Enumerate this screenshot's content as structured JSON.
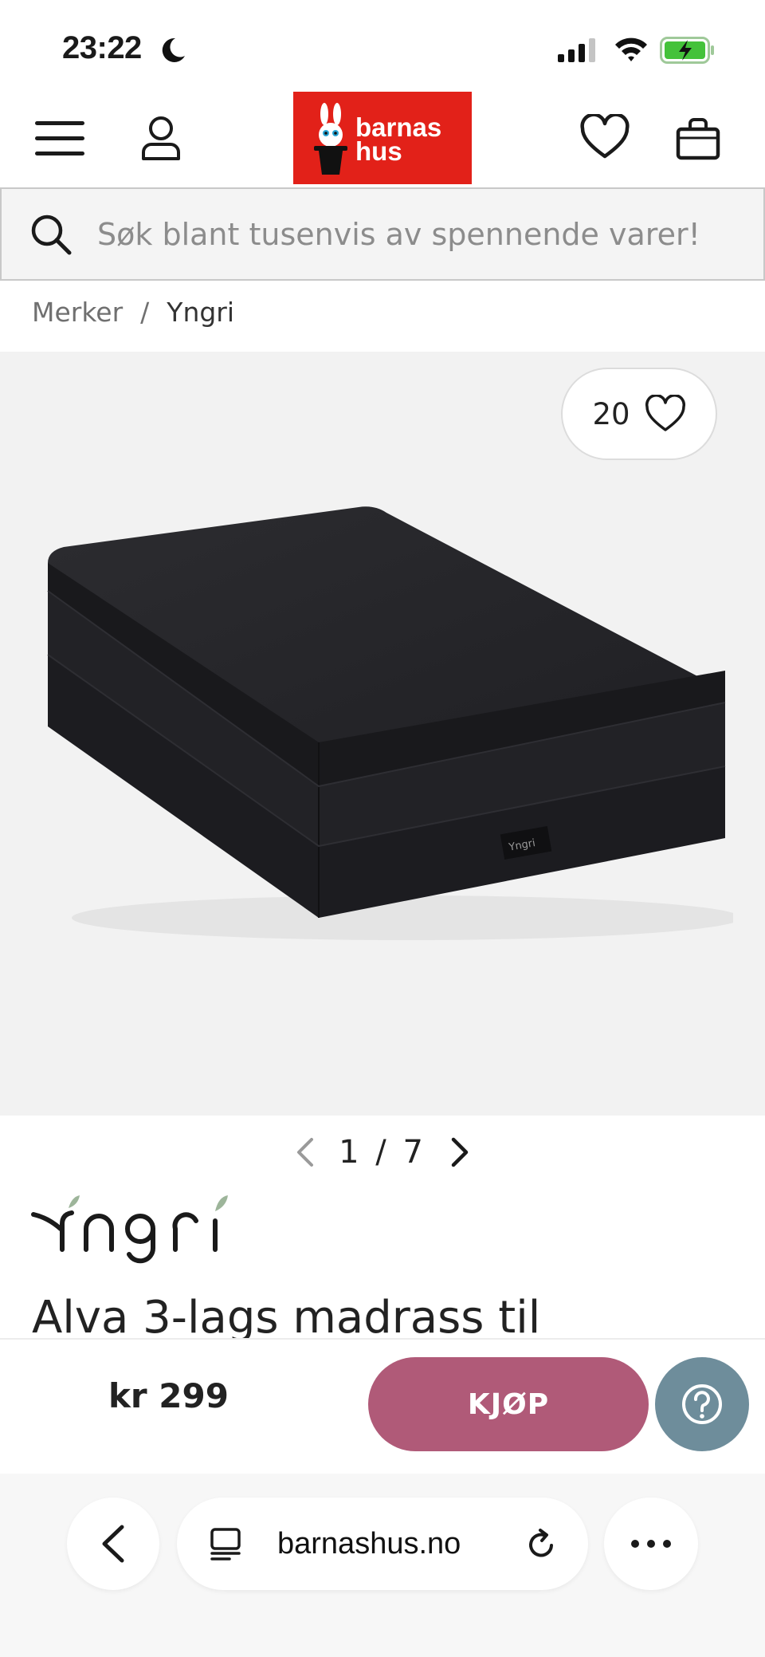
{
  "status_bar": {
    "time": "23:22",
    "icons": [
      "moon-icon",
      "signal-icon",
      "wifi-icon",
      "battery-charging-icon"
    ]
  },
  "header": {
    "logo_line1": "barnas",
    "logo_line2": "hus",
    "icons": [
      "menu-icon",
      "account-icon",
      "heart-icon",
      "bag-icon"
    ],
    "logo_color": "#e22119"
  },
  "search": {
    "placeholder": "Søk blant tusenvis av spennende varer!"
  },
  "breadcrumb": {
    "items": [
      "Merker",
      "Yngri"
    ],
    "separator": "/"
  },
  "product": {
    "favorite_count": "20",
    "image_pager": "1 / 7",
    "brand": "Yngri",
    "mattress_label": "Yngri",
    "title": "Alva 3-lags madrass til",
    "price": "kr 299",
    "buy_label": "KJØP",
    "buy_color": "#b05a78",
    "help_color": "#6e8d9b"
  },
  "browser": {
    "url": "barnashus.no",
    "icons": [
      "back-icon",
      "reader-icon",
      "reload-icon",
      "more-icon"
    ]
  }
}
